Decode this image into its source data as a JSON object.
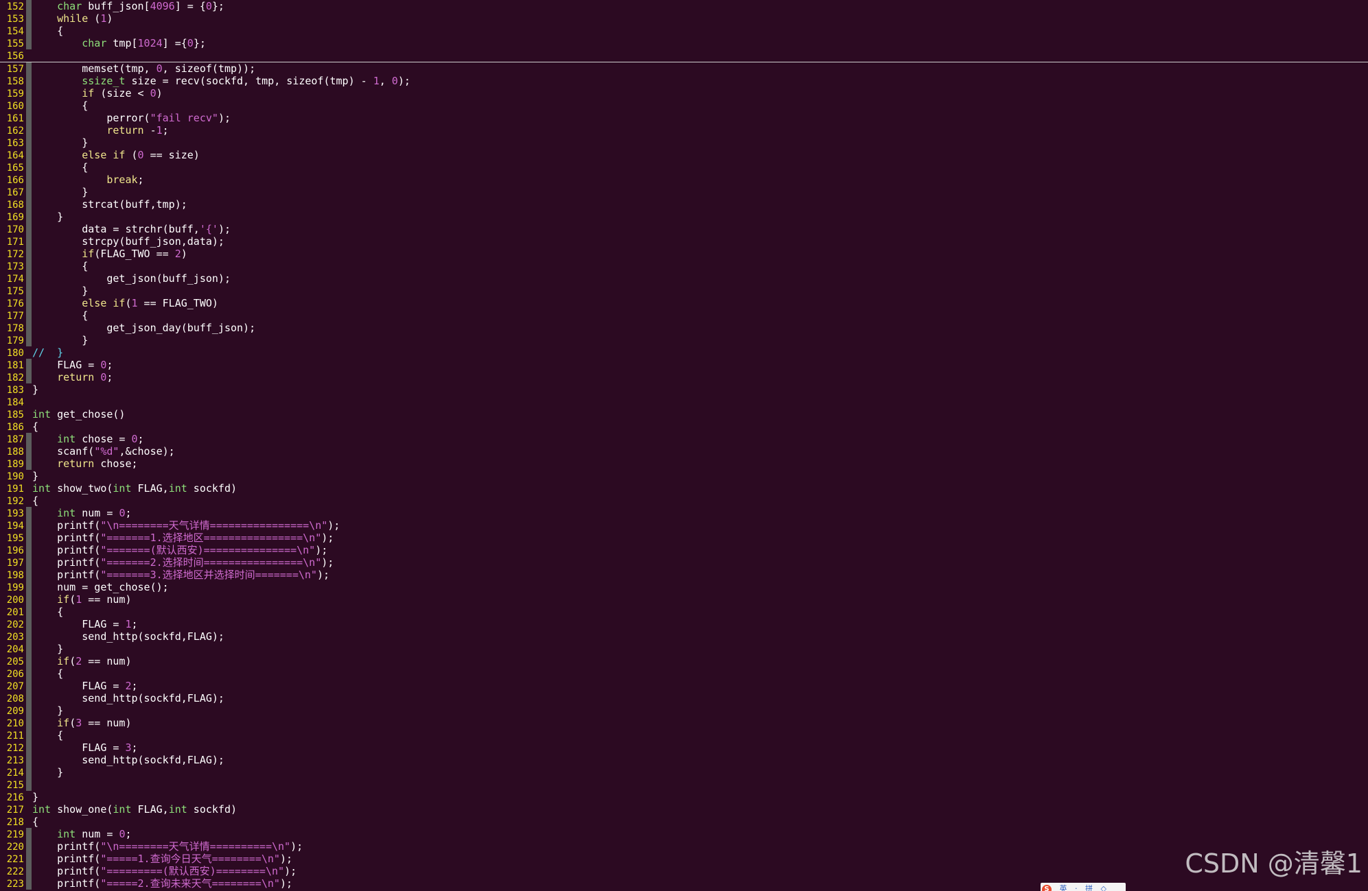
{
  "editor": {
    "lines": [
      {
        "n": "152",
        "g": 1,
        "t": "    char buff_json[4096] = {0};"
      },
      {
        "n": "153",
        "g": 1,
        "t": "    while (1)"
      },
      {
        "n": "154",
        "g": 1,
        "t": "    {"
      },
      {
        "n": "155",
        "g": 1,
        "t": "        char tmp[1024] ={0};"
      },
      {
        "n": "156",
        "g": 0,
        "t": "",
        "hr": 1
      },
      {
        "n": "157",
        "g": 1,
        "t": "        memset(tmp, 0, sizeof(tmp));"
      },
      {
        "n": "158",
        "g": 1,
        "t": "        ssize_t size = recv(sockfd, tmp, sizeof(tmp) - 1, 0);"
      },
      {
        "n": "159",
        "g": 1,
        "t": "        if (size < 0)"
      },
      {
        "n": "160",
        "g": 1,
        "t": "        {"
      },
      {
        "n": "161",
        "g": 1,
        "t": "            perror(\"fail recv\");"
      },
      {
        "n": "162",
        "g": 1,
        "t": "            return -1;"
      },
      {
        "n": "163",
        "g": 1,
        "t": "        }"
      },
      {
        "n": "164",
        "g": 1,
        "t": "        else if (0 == size)"
      },
      {
        "n": "165",
        "g": 1,
        "t": "        {"
      },
      {
        "n": "166",
        "g": 1,
        "t": "            break;"
      },
      {
        "n": "167",
        "g": 1,
        "t": "        }"
      },
      {
        "n": "168",
        "g": 1,
        "t": "        strcat(buff,tmp);"
      },
      {
        "n": "169",
        "g": 1,
        "t": "    }"
      },
      {
        "n": "170",
        "g": 1,
        "t": "        data = strchr(buff,'{');"
      },
      {
        "n": "171",
        "g": 1,
        "t": "        strcpy(buff_json,data);"
      },
      {
        "n": "172",
        "g": 1,
        "t": "        if(FLAG_TWO == 2)"
      },
      {
        "n": "173",
        "g": 1,
        "t": "        {"
      },
      {
        "n": "174",
        "g": 1,
        "t": "            get_json(buff_json);"
      },
      {
        "n": "175",
        "g": 1,
        "t": "        }"
      },
      {
        "n": "176",
        "g": 1,
        "t": "        else if(1 == FLAG_TWO)"
      },
      {
        "n": "177",
        "g": 1,
        "t": "        {"
      },
      {
        "n": "178",
        "g": 1,
        "t": "            get_json_day(buff_json);"
      },
      {
        "n": "179",
        "g": 1,
        "t": "        }"
      },
      {
        "n": "180",
        "g": 0,
        "t": "//  }"
      },
      {
        "n": "181",
        "g": 1,
        "t": "    FLAG = 0;"
      },
      {
        "n": "182",
        "g": 1,
        "t": "    return 0;"
      },
      {
        "n": "183",
        "g": 0,
        "t": "}"
      },
      {
        "n": "184",
        "g": 0,
        "t": ""
      },
      {
        "n": "185",
        "g": 0,
        "t": "int get_chose()"
      },
      {
        "n": "186",
        "g": 0,
        "t": "{"
      },
      {
        "n": "187",
        "g": 1,
        "t": "    int chose = 0;"
      },
      {
        "n": "188",
        "g": 1,
        "t": "    scanf(\"%d\",&chose);"
      },
      {
        "n": "189",
        "g": 1,
        "t": "    return chose;"
      },
      {
        "n": "190",
        "g": 0,
        "t": "}"
      },
      {
        "n": "191",
        "g": 0,
        "t": "int show_two(int FLAG,int sockfd)"
      },
      {
        "n": "192",
        "g": 0,
        "t": "{"
      },
      {
        "n": "193",
        "g": 1,
        "t": "    int num = 0;"
      },
      {
        "n": "194",
        "g": 1,
        "t": "    printf(\"\\n========天气详情================\\n\");"
      },
      {
        "n": "195",
        "g": 1,
        "t": "    printf(\"=======1.选择地区================\\n\");"
      },
      {
        "n": "196",
        "g": 1,
        "t": "    printf(\"=======(默认西安)===============\\n\");"
      },
      {
        "n": "197",
        "g": 1,
        "t": "    printf(\"=======2.选择时间================\\n\");"
      },
      {
        "n": "198",
        "g": 1,
        "t": "    printf(\"=======3.选择地区并选择时间=======\\n\");"
      },
      {
        "n": "199",
        "g": 1,
        "t": "    num = get_chose();"
      },
      {
        "n": "200",
        "g": 1,
        "t": "    if(1 == num)"
      },
      {
        "n": "201",
        "g": 1,
        "t": "    {"
      },
      {
        "n": "202",
        "g": 1,
        "t": "        FLAG = 1;"
      },
      {
        "n": "203",
        "g": 1,
        "t": "        send_http(sockfd,FLAG);"
      },
      {
        "n": "204",
        "g": 1,
        "t": "    }"
      },
      {
        "n": "205",
        "g": 1,
        "t": "    if(2 == num)"
      },
      {
        "n": "206",
        "g": 1,
        "t": "    {"
      },
      {
        "n": "207",
        "g": 1,
        "t": "        FLAG = 2;"
      },
      {
        "n": "208",
        "g": 1,
        "t": "        send_http(sockfd,FLAG);"
      },
      {
        "n": "209",
        "g": 1,
        "t": "    }"
      },
      {
        "n": "210",
        "g": 1,
        "t": "    if(3 == num)"
      },
      {
        "n": "211",
        "g": 1,
        "t": "    {"
      },
      {
        "n": "212",
        "g": 1,
        "t": "        FLAG = 3;"
      },
      {
        "n": "213",
        "g": 1,
        "t": "        send_http(sockfd,FLAG);"
      },
      {
        "n": "214",
        "g": 1,
        "t": "    }"
      },
      {
        "n": "215",
        "g": 1,
        "t": ""
      },
      {
        "n": "216",
        "g": 0,
        "t": "}"
      },
      {
        "n": "217",
        "g": 0,
        "t": "int show_one(int FLAG,int sockfd)"
      },
      {
        "n": "218",
        "g": 0,
        "t": "{"
      },
      {
        "n": "219",
        "g": 1,
        "t": "    int num = 0;"
      },
      {
        "n": "220",
        "g": 1,
        "t": "    printf(\"\\n========天气详情==========\\n\");"
      },
      {
        "n": "221",
        "g": 1,
        "t": "    printf(\"=====1.查询今日天气========\\n\");"
      },
      {
        "n": "222",
        "g": 1,
        "t": "    printf(\"=========(默认西安)========\\n\");"
      },
      {
        "n": "223",
        "g": 1,
        "t": "    printf(\"=====2.查询未来天气========\\n\");"
      }
    ]
  },
  "watermark": {
    "text": "CSDN @清馨1"
  },
  "ime": {
    "logo": "S",
    "buttons": [
      "英",
      "·",
      "拼",
      "◇"
    ]
  },
  "colors": {
    "background": "#2c0a22",
    "line_number": "#f2e024",
    "type": "#8ee07a",
    "keyword": "#f0e68c",
    "literal": "#d06bd0",
    "comment": "#5fd3e8"
  }
}
